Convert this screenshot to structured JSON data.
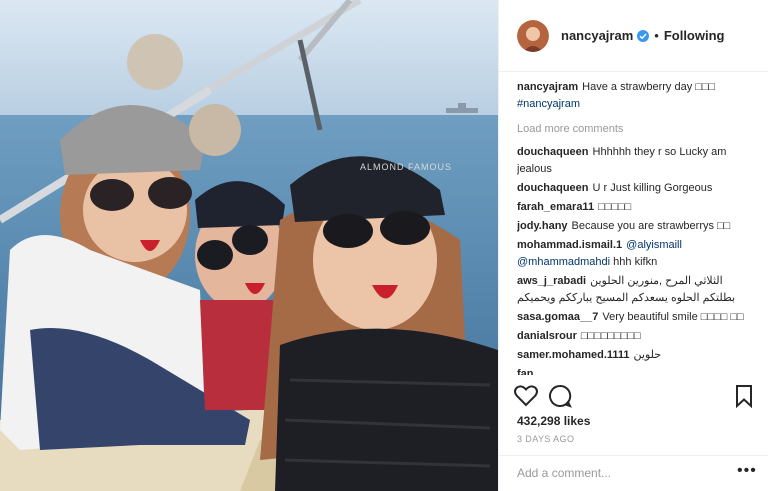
{
  "post": {
    "username": "nancyajram",
    "follow_status": "Following",
    "caption_user": "nancyajram",
    "caption_text": "Have a strawberry day □□□",
    "caption_tag": "#nancyajram",
    "load_more": "Load more comments",
    "comments": [
      {
        "user": "douchaqueen",
        "text": "Hhhhhh they r so Lucky am jealous"
      },
      {
        "user": "douchaqueen",
        "text": "U r Just killing Gorgeous"
      },
      {
        "user": "farah_emara11",
        "text": "□□□□□"
      },
      {
        "user": "jody.hany",
        "text": "Because you are strawberrys □□"
      },
      {
        "user": "mohammad.ismail.1",
        "mention1": "@alyismaill",
        "mention2": "@mhammadmahdi",
        "text": "hhh kifkn"
      },
      {
        "user": "aws_j_rabadi",
        "text": "الثلاثي المرح ,منورين الحلوين بطلتكم الحلوه يسعدكم المسيح يبارككم ويحميكم"
      },
      {
        "user": "sasa.gomaa__7",
        "text": "Very beautiful smile □□□□ □□"
      },
      {
        "user": "danialsrour",
        "text": "□□□□□□□□□"
      },
      {
        "user": "samer.mohamed.1111",
        "text": "حلوين"
      },
      {
        "user": "fan",
        "text": ""
      }
    ],
    "likes": "432,298 likes",
    "time": "3 DAYS AGO",
    "add_comment_placeholder": "Add a comment...",
    "more_label": "•••",
    "photo_text": "ALMOND FAMOUS"
  },
  "icons": {
    "like": "heart-icon",
    "comment": "comment-icon",
    "save": "bookmark-icon",
    "verified": "verified-badge-icon",
    "more": "more-options-icon"
  },
  "colors": {
    "link": "#003569",
    "verified": "#3897f0",
    "muted": "#999999",
    "text": "#262626"
  }
}
